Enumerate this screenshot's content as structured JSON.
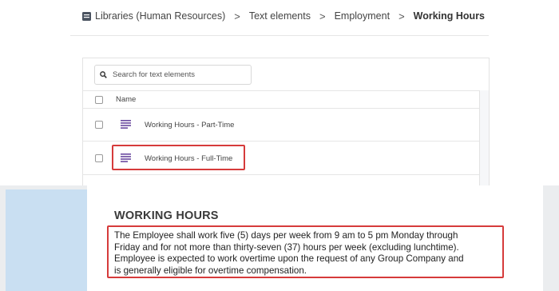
{
  "breadcrumb": {
    "icon": "library-icon",
    "items": [
      "Libraries (Human Resources)",
      "Text elements",
      "Employment"
    ],
    "current": "Working Hours",
    "separator": ">"
  },
  "search": {
    "placeholder": "Search for text elements",
    "icon": "search-icon"
  },
  "table": {
    "header": "Name",
    "rows": [
      {
        "label": "Working Hours - Part-Time",
        "icon": "text-document-icon"
      },
      {
        "label": "Working Hours - Full-Time",
        "icon": "text-document-icon",
        "highlighted": true
      }
    ]
  },
  "document": {
    "heading": "WORKING HOURS",
    "lines": [
      "The Employee shall work five (5) days per week from 9 am to 5 pm Monday through",
      "Friday and for not more than thirty-seven (37) hours per week (excluding lunchtime).",
      "Employee is expected to work overtime upon the request of any Group Company and",
      "is generally eligible for overtime compensation."
    ]
  },
  "colors": {
    "highlight": "#d63b3b",
    "icon_purple": "#6b4aa0",
    "margin_blue": "#c9dff2"
  }
}
